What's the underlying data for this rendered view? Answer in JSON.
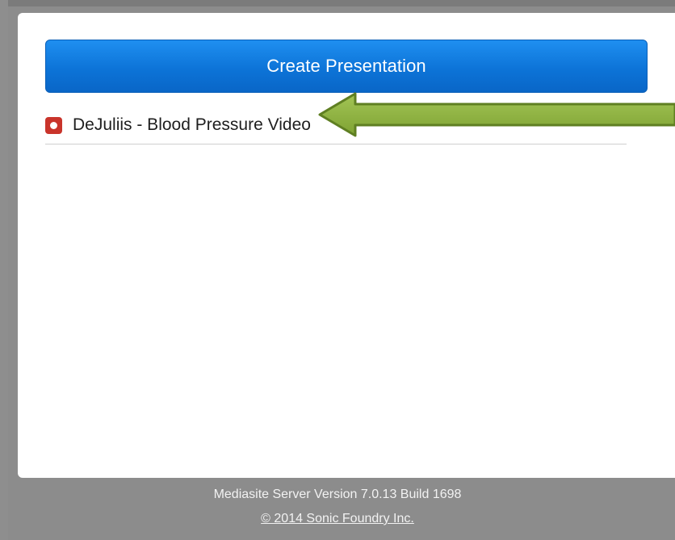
{
  "header": {
    "create_button_label": "Create Presentation"
  },
  "presentations": [
    {
      "title": "DeJuliis - Blood Pressure Video",
      "icon": "record-icon",
      "icon_color": "#c9342b"
    }
  ],
  "annotation": {
    "type": "arrow",
    "color": "#8db23d",
    "points_to": "DeJuliis - Blood Pressure Video"
  },
  "footer": {
    "version": "Mediasite Server Version 7.0.13 Build 1698",
    "copyright": "© 2014 Sonic Foundry Inc."
  },
  "colors": {
    "accent": "#0d74d8",
    "panel": "#ffffff",
    "background": "#8c8c8c"
  }
}
